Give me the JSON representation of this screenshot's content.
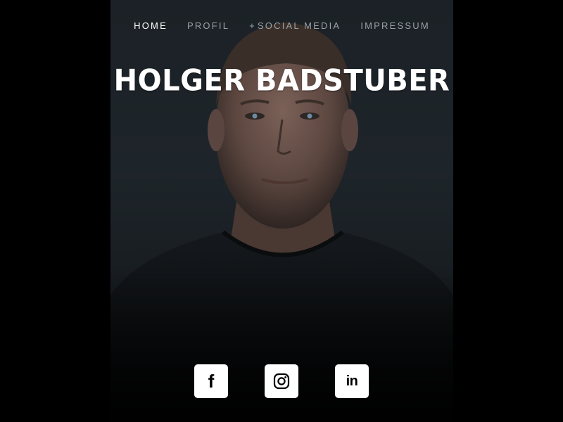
{
  "nav": {
    "items": [
      {
        "label": "HOME",
        "active": true
      },
      {
        "label": "PROFIL",
        "active": false
      },
      {
        "label": "SOCIAL MEDIA",
        "prefix": "+",
        "active": false
      },
      {
        "label": "IMPRESSUM",
        "active": false
      }
    ]
  },
  "hero": {
    "title": "HOLGER BADSTUBER"
  },
  "social": {
    "facebook": {
      "icon": "facebook-icon",
      "glyph": "f"
    },
    "instagram": {
      "icon": "instagram-icon"
    },
    "linkedin": {
      "icon": "linkedin-icon",
      "glyph": "in"
    }
  },
  "colors": {
    "background": "#000000",
    "nav_active": "#ffffff",
    "nav_inactive": "#9aa2a6",
    "title": "#ffffff",
    "button_bg": "#ffffff"
  }
}
